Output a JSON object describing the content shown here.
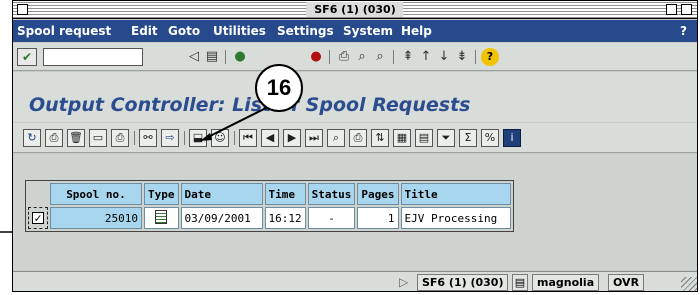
{
  "window": {
    "title": "SF6 (1) (030)"
  },
  "menubar": {
    "items": [
      "Spool request",
      "Edit",
      "Goto",
      "Utilities",
      "Settings",
      "System",
      "Help"
    ],
    "help_button": "?"
  },
  "system_toolbar": {
    "command_field_value": "",
    "icons": [
      "enter-icon",
      "back-icon",
      "save-icon",
      "exit-icon",
      "cancel-icon",
      "print-icon",
      "find-icon",
      "find-next-icon",
      "first-page-icon",
      "previous-page-icon",
      "next-page-icon",
      "last-page-icon",
      "help-icon"
    ]
  },
  "screen": {
    "title": "Output Controller: List of Spool Requests"
  },
  "app_toolbar": {
    "icons": [
      "refresh-icon",
      "print-directly-icon",
      "delete-icon",
      "display-contents-icon",
      "print-with-changed-attributes-icon",
      "display-output-requests-icon",
      "forward-icon",
      "archive-icon",
      "user-icon",
      "first-icon",
      "previous-icon",
      "next-icon",
      "last-icon",
      "search-icon",
      "print-list-icon",
      "sort-icon",
      "choose-layout-icon",
      "export-icon",
      "filter-icon",
      "sum-icon",
      "percent-icon",
      "info-icon"
    ]
  },
  "table": {
    "headers": [
      "Spool no.",
      "Type",
      "Date",
      "Time",
      "Status",
      "Pages",
      "Title"
    ],
    "rows": [
      {
        "checked": "✓",
        "spool_no": "25010",
        "date": "03/09/2001",
        "time": "16:12",
        "status": "-",
        "pages": "1",
        "title": "EJV Processing"
      }
    ]
  },
  "statusbar": {
    "system": "SF6 (1) (030)",
    "server": "magnolia",
    "mode": "OVR"
  },
  "callout": {
    "number": "16"
  }
}
